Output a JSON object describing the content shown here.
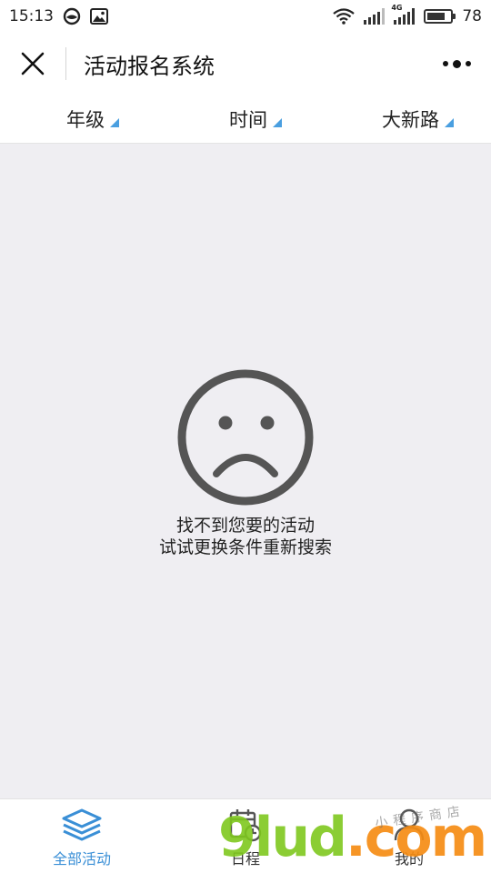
{
  "status_bar": {
    "time": "15:13",
    "network_label": "4G",
    "battery_level": "78",
    "battery_fill_fraction": 0.78,
    "icons": [
      "browser-icon",
      "image-icon",
      "wifi-icon",
      "signal-icon",
      "signal-4g-icon",
      "battery-icon"
    ]
  },
  "header": {
    "title": "活动报名系统",
    "close_icon": "close-icon",
    "more_icon": "more-dots-icon"
  },
  "filters": [
    {
      "label": "年级"
    },
    {
      "label": "时间"
    },
    {
      "label": "大新路"
    }
  ],
  "empty_state": {
    "icon": "sad-face-icon",
    "line1": "找不到您要的活动",
    "line2": "试试更换条件重新搜索"
  },
  "tabbar": {
    "tabs": [
      {
        "label": "全部活动",
        "icon": "layers-icon",
        "active": true
      },
      {
        "label": "日程",
        "icon": "calendar-clock-icon",
        "active": false
      },
      {
        "label": "我的",
        "icon": "user-icon",
        "active": false
      }
    ]
  },
  "watermark": {
    "main": "9lud",
    "suffix": ".com",
    "sub": "小程序商店"
  },
  "colors": {
    "accent": "#3a8fd6",
    "background": "#efeef2",
    "triangle": "#4a9fe0"
  }
}
